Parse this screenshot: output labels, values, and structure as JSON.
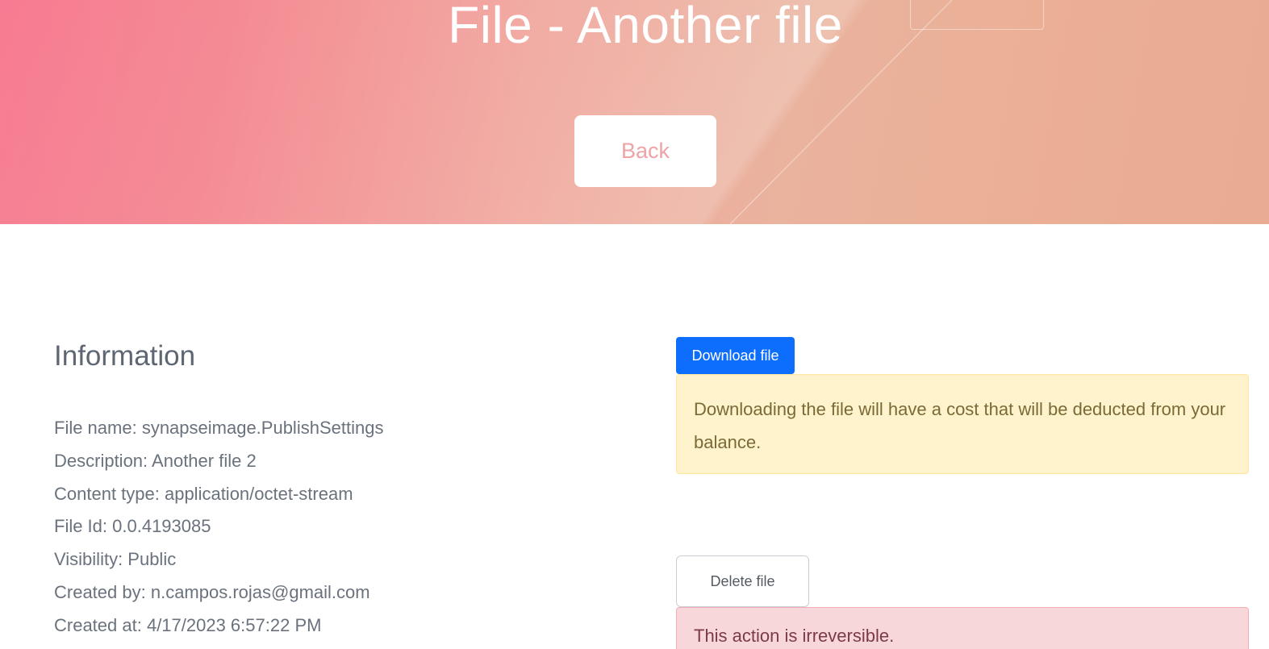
{
  "header": {
    "title": "File - Another file",
    "back_label": "Back"
  },
  "information": {
    "heading": "Information",
    "rows": [
      "File name: synapseimage.PublishSettings",
      "Description: Another file 2",
      "Content type: application/octet-stream",
      "File Id: 0.0.4193085",
      "Visibility: Public",
      "Created by: n.campos.rojas@gmail.com",
      "Created at: 4/17/2023 6:57:22 PM"
    ]
  },
  "download": {
    "button_label": "Download file",
    "warning": "Downloading the file will have a cost that will be deducted from your balance."
  },
  "delete": {
    "button_label": "Delete file",
    "warning": "This action is irreversible."
  },
  "colors": {
    "primary": "#0d6efd",
    "warning_bg": "#fff3cd",
    "danger_bg": "#f8d7da",
    "hero_start": "#f77b92",
    "hero_end": "#e9ab92"
  }
}
